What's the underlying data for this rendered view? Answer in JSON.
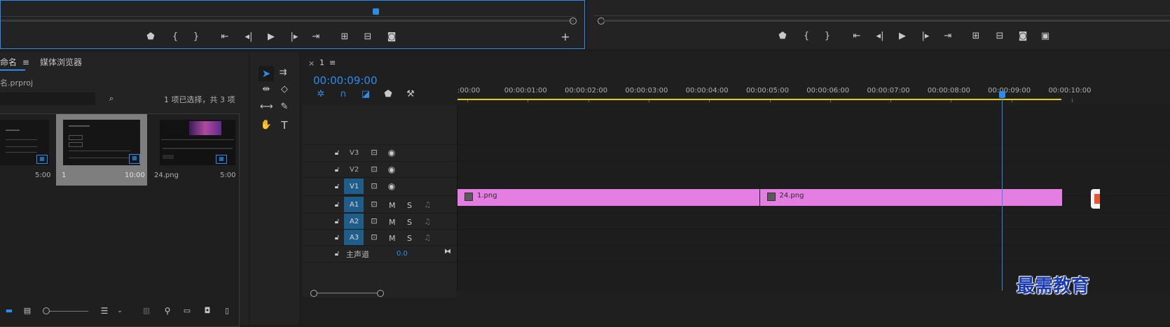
{
  "source_monitor": {
    "controls": [
      "marker",
      "mark-in",
      "mark-out",
      "go-to-in",
      "step-back",
      "play",
      "step-forward",
      "go-to-out",
      "insert",
      "overwrite",
      "export-frame",
      "add"
    ],
    "add_label": "+"
  },
  "program_monitor": {
    "controls": [
      "marker",
      "mark-in",
      "mark-out",
      "go-to-in",
      "step-back",
      "play",
      "step-forward",
      "go-to-out",
      "lift",
      "extract",
      "export-frame",
      "compare"
    ]
  },
  "project": {
    "tab_name": "命名",
    "tab_menu": "≡",
    "tab_media_browser": "媒体浏览器",
    "file_name": "名.prproj",
    "search_placeholder": "",
    "selection_status": "1 项已选择，共 3 项",
    "items": [
      {
        "name": "",
        "duration": "5:00",
        "selected": false
      },
      {
        "name": "1",
        "duration": "10:00",
        "selected": true
      },
      {
        "name": "24.png",
        "duration": "5:00",
        "selected": false
      }
    ]
  },
  "tools": [
    "selection",
    "track-select",
    "ripple-edit",
    "razor",
    "slip",
    "pen",
    "hand",
    "type"
  ],
  "timeline": {
    "close": "×",
    "sequence_name": "1",
    "menu": "≡",
    "timecode": "00:00:09:00",
    "ruler": [
      ":00:00",
      "00:00:01:00",
      "00:00:02:00",
      "00:00:03:00",
      "00:00:04:00",
      "00:00:05:00",
      "00:00:06:00",
      "00:00:07:00",
      "00:00:08:00",
      "00:00:09:00",
      "00:00:10:00"
    ],
    "playhead_seconds": 9,
    "tracks_video": [
      "V3",
      "V2",
      "V1"
    ],
    "tracks_audio": [
      "A1",
      "A2",
      "A3"
    ],
    "mute": "M",
    "solo": "S",
    "master_label": "主声道",
    "master_value": "0.0",
    "clips": [
      {
        "name": "1.png",
        "start": 0,
        "end": 5
      },
      {
        "name": "24.png",
        "start": 5,
        "end": 10
      }
    ]
  },
  "watermark": "最需教育",
  "colors": {
    "accent": "#2d8ceb",
    "clip": "#e57ee3",
    "work_area": "#e6d200"
  }
}
